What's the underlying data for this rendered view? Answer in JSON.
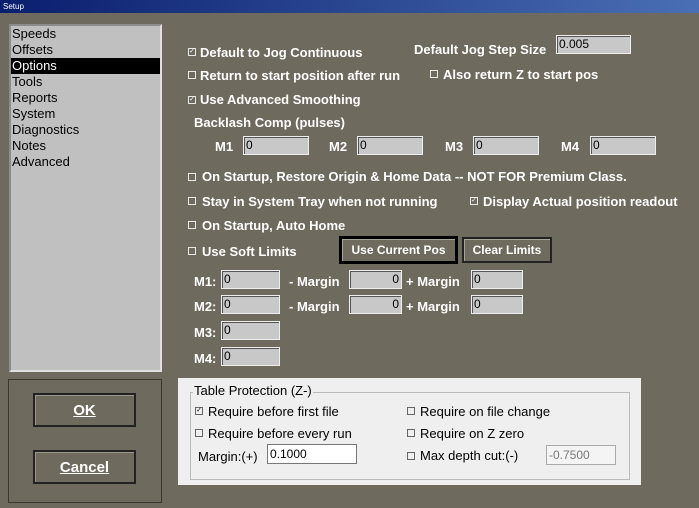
{
  "window": {
    "title": "Setup"
  },
  "sidebar": {
    "items": [
      {
        "label": "Speeds",
        "selected": false
      },
      {
        "label": "Offsets",
        "selected": false
      },
      {
        "label": "Options",
        "selected": true
      },
      {
        "label": "Tools",
        "selected": false
      },
      {
        "label": "Reports",
        "selected": false
      },
      {
        "label": "System",
        "selected": false
      },
      {
        "label": "Diagnostics",
        "selected": false
      },
      {
        "label": "Notes",
        "selected": false
      },
      {
        "label": "Advanced",
        "selected": false
      }
    ]
  },
  "buttons": {
    "ok": "OK",
    "cancel": "Cancel"
  },
  "options": {
    "jog_continuous": {
      "label": "Default to Jog Continuous",
      "checked": true
    },
    "jog_step_label": "Default Jog Step Size",
    "jog_step_value": "0.005",
    "return_start": {
      "label": "Return to start position after run",
      "checked": false
    },
    "return_z": {
      "label": "Also return Z to start pos",
      "checked": false
    },
    "adv_smoothing": {
      "label": "Use Advanced Smoothing",
      "checked": true
    },
    "backlash_label": "Backlash Comp (pulses)",
    "backlash": [
      {
        "label": "M1",
        "value": "0"
      },
      {
        "label": "M2",
        "value": "0"
      },
      {
        "label": "M3",
        "value": "0"
      },
      {
        "label": "M4",
        "value": "0"
      }
    ],
    "restore_origin": {
      "label": "On Startup, Restore Origin & Home Data -- NOT FOR Premium Class.",
      "checked": false
    },
    "system_tray": {
      "label": "Stay in System Tray when not running",
      "checked": false
    },
    "display_actual": {
      "label": "Display Actual position readout",
      "checked": true
    },
    "auto_home": {
      "label": "On Startup, Auto Home",
      "checked": false
    },
    "soft_limits": {
      "label": "Use Soft Limits",
      "checked": false
    },
    "use_current_pos": "Use Current Pos",
    "clear_limits": "Clear Limits",
    "minus_margin": "- Margin",
    "plus_margin": "+ Margin",
    "limits": [
      {
        "label": "M1:",
        "value": "0",
        "minus": "0",
        "plus": "0"
      },
      {
        "label": "M2:",
        "value": "0",
        "minus": "0",
        "plus": "0"
      },
      {
        "label": "M3:",
        "value": "0"
      },
      {
        "label": "M4:",
        "value": "0"
      }
    ]
  },
  "table_protection": {
    "title": "Table Protection (Z-)",
    "first_file": {
      "label": "Require before first file",
      "checked": true
    },
    "every_run": {
      "label": "Require before every run",
      "checked": false
    },
    "file_change": {
      "label": "Require on file change",
      "checked": false
    },
    "z_zero": {
      "label": "Require on Z zero",
      "checked": false
    },
    "margin_label": "Margin:(+)",
    "margin_value": "0.1000",
    "max_depth": {
      "label": "Max depth cut:(-)",
      "checked": false
    },
    "max_depth_value": "-0.7500"
  }
}
